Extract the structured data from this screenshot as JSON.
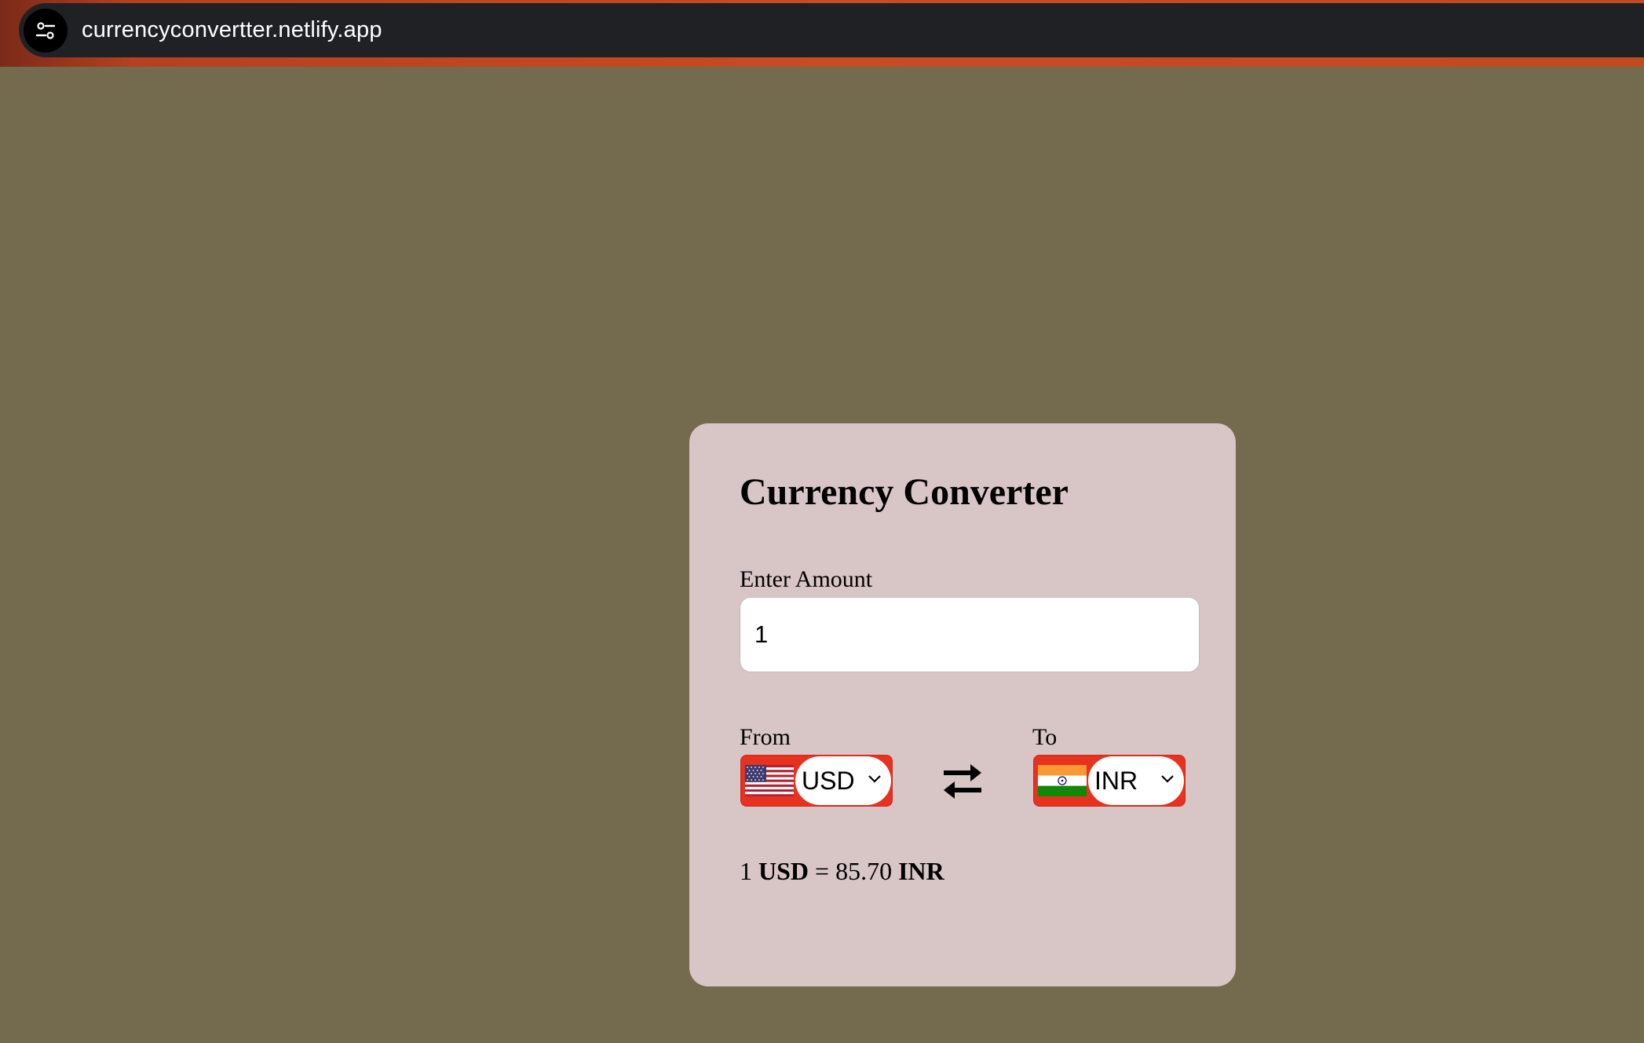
{
  "browser": {
    "url": "currencyconvertter.netlify.app",
    "site_settings_icon": "tune-icon"
  },
  "converter": {
    "title": "Currency Converter",
    "amount_label": "Enter Amount",
    "amount_value": "1",
    "from_label": "From",
    "to_label": "To",
    "from_currency": "USD",
    "to_currency": "INR",
    "from_flag": "us-flag-icon",
    "to_flag": "in-flag-icon",
    "swap_icon": "swap-arrows-icon",
    "result": {
      "amount": "1",
      "from": "USD",
      "equals": "=",
      "value": "85.70",
      "to": "INR"
    }
  },
  "colors": {
    "page_background": "#746a4d",
    "card_background": "#d8c6c6",
    "selector_accent": "#e6321f",
    "browser_bar": "#1f2124",
    "browser_frame": "#c84b22"
  }
}
